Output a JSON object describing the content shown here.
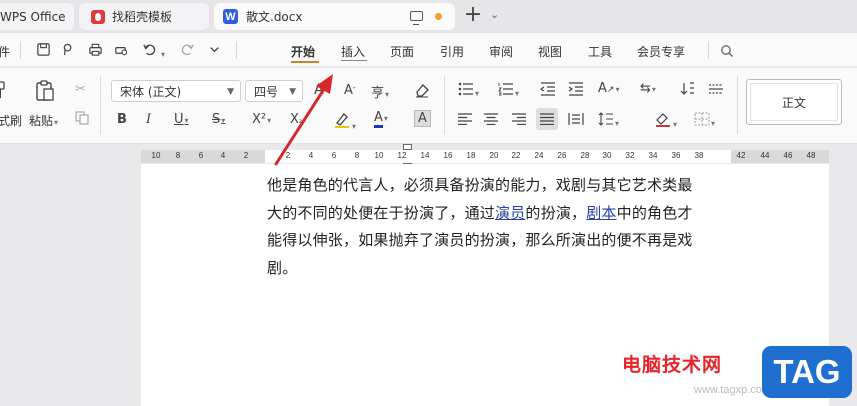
{
  "tabs": [
    {
      "label": "WPS Office"
    },
    {
      "label": "找稻壳模板"
    },
    {
      "label": "散文.docx"
    }
  ],
  "tabbar": {
    "add_label": "+",
    "list_label": "⌄"
  },
  "menu": {
    "file_label": "件",
    "items": [
      "开始",
      "插入",
      "页面",
      "引用",
      "审阅",
      "视图",
      "工具",
      "会员专享"
    ]
  },
  "ribbon": {
    "format_painter": "式刷",
    "paste": "粘贴",
    "font_name": "宋体 (正文)",
    "font_size": "四号",
    "bold": "B",
    "italic": "I",
    "underline": "U",
    "strike": "S",
    "superscript": "X²",
    "font_color": "A",
    "char_shade": "A",
    "pinyin": "亨",
    "style_normal": "正文"
  },
  "ruler": {
    "ticks": [
      "10",
      "8",
      "6",
      "4",
      "2",
      "2",
      "4",
      "6",
      "8",
      "10",
      "12",
      "14",
      "16",
      "18",
      "20",
      "22",
      "24",
      "26",
      "28",
      "30",
      "32",
      "34",
      "36",
      "38",
      "42",
      "44",
      "46",
      "48"
    ]
  },
  "document": {
    "lines": [
      [
        {
          "t": "他是角色的代言人，必须具备扮演的能力，戏剧与其它艺术类最"
        }
      ],
      [
        {
          "t": "大的不同的处便在于扮演了，通过"
        },
        {
          "t": "演员",
          "link": true
        },
        {
          "t": "的扮演，"
        },
        {
          "t": "剧本",
          "link": true
        },
        {
          "t": "中的角色才"
        }
      ],
      [
        {
          "t": "能得以伸张，如果抛弃了演员的扮演，那么所演出的便不再是戏"
        }
      ],
      [
        {
          "t": "剧。"
        }
      ]
    ]
  },
  "watermark": {
    "text": "电脑技术网",
    "tag": "TAG",
    "url": "www.tagxp.com"
  },
  "colors": {
    "accent": "#c9852a",
    "link": "#2741a8",
    "arrow": "#d9262b",
    "tag_bg": "#1f6fd1",
    "word_icon": "#2f5ee0"
  },
  "icons": [
    "save-icon",
    "print-icon",
    "undo-icon",
    "redo-icon",
    "search-icon",
    "screen-mode-icon",
    "eraser-icon"
  ]
}
